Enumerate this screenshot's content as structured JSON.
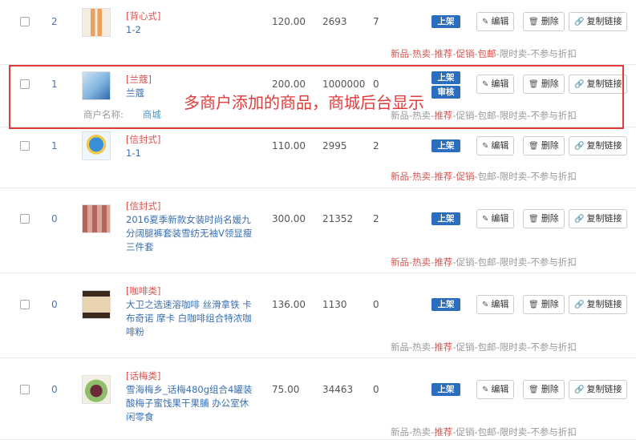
{
  "actions": {
    "shelf": "上架",
    "edit": "编辑",
    "delete": "删除",
    "copy": "复制链接"
  },
  "tag_separator": "-",
  "rows": [
    {
      "sort": "2",
      "category": "[背心式]",
      "name": [
        "1-2"
      ],
      "price": "120.00",
      "stock": "2693",
      "sales": "7",
      "tags": [
        {
          "text": "新品",
          "color": "red"
        },
        {
          "text": "热卖",
          "color": "red"
        },
        {
          "text": "推荐",
          "color": "red"
        },
        {
          "text": "促销",
          "color": "red"
        },
        {
          "text": "包邮",
          "color": "red"
        },
        {
          "text": "限时卖",
          "color": "grey"
        },
        {
          "text": "不参与折扣",
          "color": "grey"
        }
      ]
    },
    {
      "sort": "1",
      "category": "[兰蔻]",
      "name": [
        "兰蔻"
      ],
      "price": "200.00",
      "stock": "1000000",
      "sales": "0",
      "second_badge": "审核",
      "merchant_label": "商户名称:",
      "merchant_shop": "商城",
      "tags": [
        {
          "text": "新品",
          "color": "grey"
        },
        {
          "text": "热卖",
          "color": "grey"
        },
        {
          "text": "推荐",
          "color": "red"
        },
        {
          "text": "促销",
          "color": "grey"
        },
        {
          "text": "包邮",
          "color": "grey"
        },
        {
          "text": "限时卖",
          "color": "grey"
        },
        {
          "text": "不参与折扣",
          "color": "grey"
        }
      ]
    },
    {
      "sort": "1",
      "category": "[信封式]",
      "name": [
        "1-1"
      ],
      "price": "110.00",
      "stock": "2995",
      "sales": "2",
      "tags": [
        {
          "text": "新品",
          "color": "red"
        },
        {
          "text": "热卖",
          "color": "red"
        },
        {
          "text": "推荐",
          "color": "red"
        },
        {
          "text": "促销",
          "color": "red"
        },
        {
          "text": "包邮",
          "color": "grey"
        },
        {
          "text": "限时卖",
          "color": "grey"
        },
        {
          "text": "不参与折扣",
          "color": "grey"
        }
      ]
    },
    {
      "sort": "0",
      "category": "[信封式]",
      "name": [
        "2016夏季新款女装时尚名媛九",
        "分阔腿裤套装雪纺无袖V领显瘦",
        "三件套"
      ],
      "price": "300.00",
      "stock": "21352",
      "sales": "2",
      "tags": [
        {
          "text": "新品",
          "color": "red"
        },
        {
          "text": "热卖",
          "color": "red"
        },
        {
          "text": "推荐",
          "color": "red"
        },
        {
          "text": "促销",
          "color": "grey"
        },
        {
          "text": "包邮",
          "color": "grey"
        },
        {
          "text": "限时卖",
          "color": "grey"
        },
        {
          "text": "不参与折扣",
          "color": "grey"
        }
      ]
    },
    {
      "sort": "0",
      "category": "[咖啡类]",
      "name": [
        "大卫之选速溶咖啡 丝滑拿铁 卡",
        "布奇诺 摩卡 白咖啡组合特浓咖",
        "啡粉"
      ],
      "price": "136.00",
      "stock": "1130",
      "sales": "0",
      "tags": [
        {
          "text": "新品",
          "color": "grey"
        },
        {
          "text": "热卖",
          "color": "grey"
        },
        {
          "text": "推荐",
          "color": "red"
        },
        {
          "text": "促销",
          "color": "grey"
        },
        {
          "text": "包邮",
          "color": "grey"
        },
        {
          "text": "限时卖",
          "color": "grey"
        },
        {
          "text": "不参与折扣",
          "color": "grey"
        }
      ]
    },
    {
      "sort": "0",
      "category": "[话梅类]",
      "name": [
        "雪海梅乡_话梅480g组合4罐装",
        "酸梅子蜜饯果干果脯 办公室休",
        "闲零食"
      ],
      "price": "75.00",
      "stock": "34463",
      "sales": "0",
      "tags": [
        {
          "text": "新品",
          "color": "grey"
        },
        {
          "text": "热卖",
          "color": "grey"
        },
        {
          "text": "推荐",
          "color": "red"
        },
        {
          "text": "促销",
          "color": "grey"
        },
        {
          "text": "包邮",
          "color": "grey"
        },
        {
          "text": "限时卖",
          "color": "grey"
        },
        {
          "text": "不参与折扣",
          "color": "grey"
        }
      ]
    }
  ],
  "annotation": "多商户添加的商品，商城后台显示",
  "colors": {
    "link_blue": "#3a6fb0",
    "badge_blue": "#2a6ebd",
    "tag_red": "#d9534f",
    "highlight_red": "#e23b3b"
  }
}
